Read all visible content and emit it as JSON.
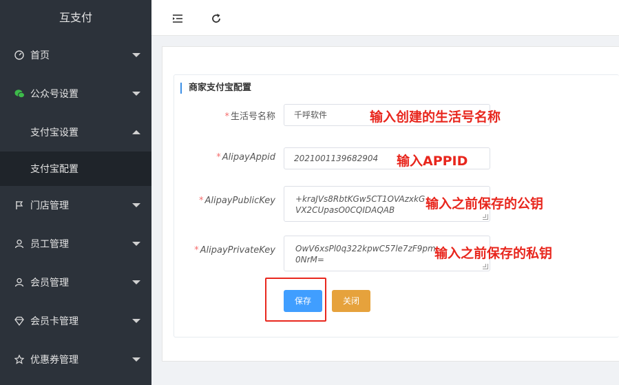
{
  "sidebar": {
    "title": "互支付",
    "items": [
      {
        "label": "首页",
        "icon": "dashboard-icon"
      },
      {
        "label": "公众号设置",
        "icon": "wechat-icon"
      },
      {
        "label": "支付宝设置",
        "icon": ""
      },
      {
        "label": "支付宝配置",
        "icon": ""
      },
      {
        "label": "门店管理",
        "icon": "flag-icon"
      },
      {
        "label": "员工管理",
        "icon": "user-icon"
      },
      {
        "label": "会员管理",
        "icon": "user-icon"
      },
      {
        "label": "会员卡管理",
        "icon": "diamond-icon"
      },
      {
        "label": "优惠券管理",
        "icon": "star-icon"
      }
    ]
  },
  "topbar": {
    "icons": [
      "menu-fold-icon",
      "refresh-icon"
    ]
  },
  "card": {
    "title": "商家支付宝配置"
  },
  "form": {
    "life_name": {
      "label": "生活号名称",
      "value": "千呼软件"
    },
    "appid": {
      "label": "AlipayAppid",
      "value": "2021001139682904"
    },
    "public_key": {
      "label": "AlipayPublicKey",
      "line1": "+kraJVs8RbtKGw5CT1OVAzxkG",
      "line2": "VX2CUpasO0CQIDAQAB"
    },
    "private_key": {
      "label": "AlipayPrivateKey",
      "line1": "OwV6xsPl0q322kpwC57le7zF9pm",
      "line2": "0NrM="
    }
  },
  "annotations": {
    "life_name": "输入创建的生活号名称",
    "appid": "输入APPID",
    "public_key": "输入之前保存的公钥",
    "private_key": "输入之前保存的私钥"
  },
  "buttons": {
    "save": "保存",
    "close": "关闭"
  },
  "colors": {
    "sidebar_bg": "#2c323a",
    "primary": "#409eff",
    "warning": "#e6a23c",
    "annotation_red": "#e8261d"
  }
}
